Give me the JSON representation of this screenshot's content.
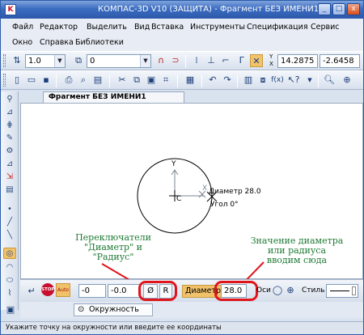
{
  "window": {
    "title": "КОМПАС-3D V10 (ЗАЩИТА) - Фрагмент БЕЗ ИМЕНИ1",
    "app_icon": "K",
    "controls": {
      "minimize": "_",
      "maximize": "□",
      "close": "x"
    }
  },
  "menu": {
    "row1": [
      "Файл",
      "Редактор",
      "Выделить",
      "Вид",
      "Вставка",
      "Инструменты",
      "Спецификация",
      "Сервис"
    ],
    "row2": [
      "Окно",
      "Справка",
      "Библиотеки"
    ]
  },
  "toolbar1": {
    "line_style": "1.0",
    "layer": "0",
    "coord_x": "14.2875",
    "coord_y": "-2.6458",
    "coord_xy_label": "Y\nX"
  },
  "toolbar2": {
    "fx_label": "f(x)"
  },
  "document": {
    "tab_title": "Фрагмент БЕЗ ИМЕНИ1",
    "axis_y_label": "Y",
    "axis_x_label": "X",
    "center_label": "C",
    "diameter_hint": "Диаметр 28.0",
    "angle_hint": "Угол 0°"
  },
  "annotations": {
    "left": "Переключатели\n\"Диаметр\" и\n\"Радиус\"",
    "right": "Значение диаметра\nили радиуса\nвводим сюда"
  },
  "property_bar": {
    "center_x": "-0",
    "center_y": "-0.0",
    "diameter_symbol": "Ø",
    "radius_label": "R",
    "diameter_label": "Диаметр",
    "diameter_value": "28.0",
    "axes_label": "Оси",
    "style_label": "Стиль",
    "stop_label": "STOP",
    "auto_label": "Auto"
  },
  "bottom_tab": "Окружность",
  "status": "Укажите точку на окружности или введите ее координаты",
  "colors": {
    "highlight": "#e0151b",
    "annotation": "#1d7a33",
    "diameter_field": "#f2c26b"
  }
}
